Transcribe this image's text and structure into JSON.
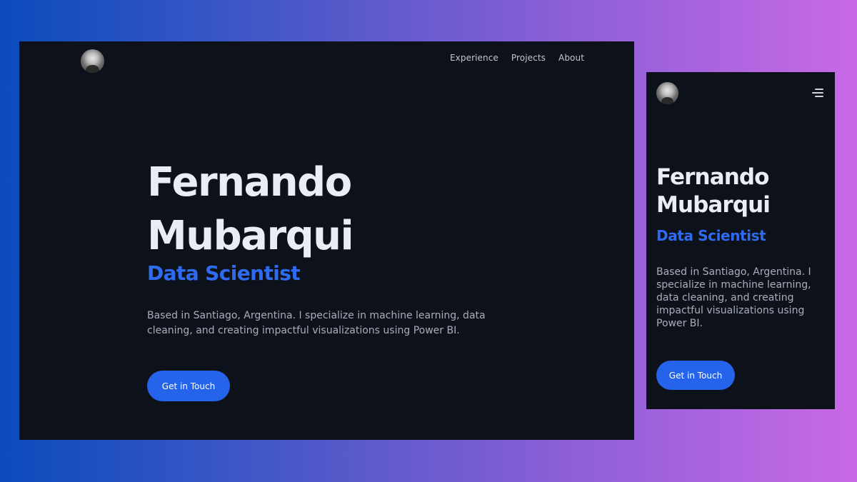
{
  "desktop": {
    "nav": [
      {
        "label": "Experience"
      },
      {
        "label": "Projects"
      },
      {
        "label": "About"
      }
    ],
    "hero": {
      "name_first": "Fernando",
      "name_last": "Mubarqui",
      "role": "Data Scientist",
      "bio": "Based in Santiago, Argentina. I specialize in machine learning, data cleaning, and creating impactful visualizations using Power BI.",
      "cta_label": "Get in Touch"
    }
  },
  "mobile": {
    "menu_icon": "hamburger-menu-icon",
    "hero": {
      "name_first": "Fernando",
      "name_last": "Mubarqui",
      "role": "Data Scientist",
      "bio": "Based in Santiago, Argentina. I specialize in machine learning, data cleaning, and creating impactful visualizations using Power BI.",
      "cta_label": "Get in Touch"
    }
  },
  "colors": {
    "background_start": "#0a4bbd",
    "background_end": "#c969e6",
    "frame": "#0d1119",
    "accent": "#2563eb",
    "heading": "#e9edf5",
    "body_text": "#a8aebb"
  }
}
